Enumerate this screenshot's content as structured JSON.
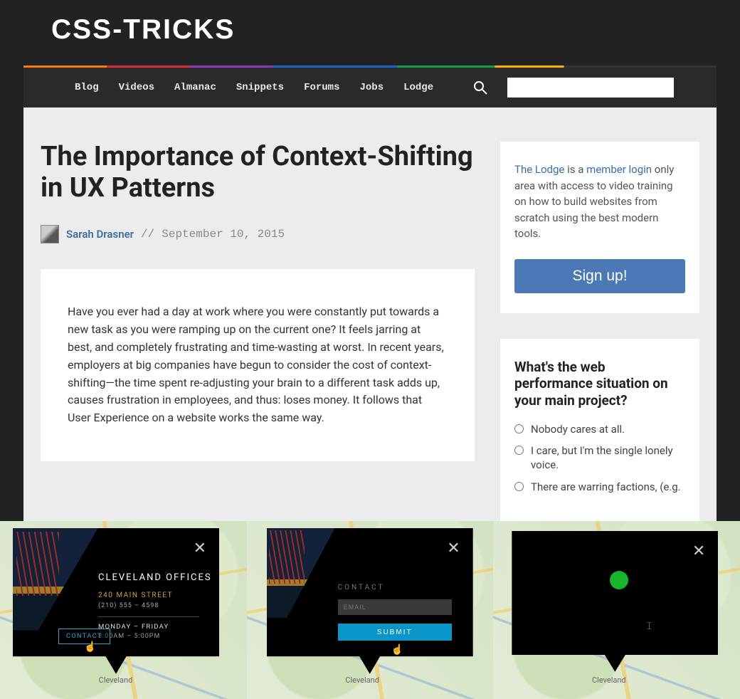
{
  "logo": "CSS-TRICKS",
  "nav": {
    "items": [
      "Blog",
      "Videos",
      "Almanac",
      "Snippets",
      "Forums",
      "Jobs",
      "Lodge"
    ],
    "search_placeholder": ""
  },
  "article": {
    "title": "The Importance of Context-Shifting in UX Patterns",
    "author": "Sarah Drasner",
    "date": "September 10, 2015",
    "body_p1": "Have you ever had a day at work where you were constantly put towards a new task as you were ramping up on the current one? It feels jarring at best, and completely frustrating and time-wasting at worst. In recent years, employers at big companies have begun to consider the cost of context-shifting—the time spent re-adjusting your brain to a different task adds up, causes frustration in employees, and thus: loses money. It follows that User Experience on a website works the same way."
  },
  "sidebar": {
    "lodge": {
      "link1": "The Lodge",
      "mid1": " is a ",
      "link2": "member login",
      "rest": " only area with access to video training on how to build websites from scratch using the best modern tools.",
      "signup": "Sign up!"
    },
    "poll": {
      "title": "What's the web performance situation on your main project?",
      "options": [
        "Nobody cares at all.",
        "I care, but I'm the single lonely voice.",
        "There are warring factions, (e.g."
      ]
    }
  },
  "panels": {
    "city_label": "Cleveland",
    "p1": {
      "heading": "CLEVELAND OFFICES",
      "address": "240 MAIN STREET",
      "phone": "(210) 555 – 4598",
      "days": "MONDAY – FRIDAY",
      "hours": "8:00AM – 5:00PM",
      "contact_btn": "CONTACT"
    },
    "p2": {
      "contact_label": "CONTACT",
      "email_placeholder": "EMAIL",
      "submit": "SUBMIT"
    }
  }
}
